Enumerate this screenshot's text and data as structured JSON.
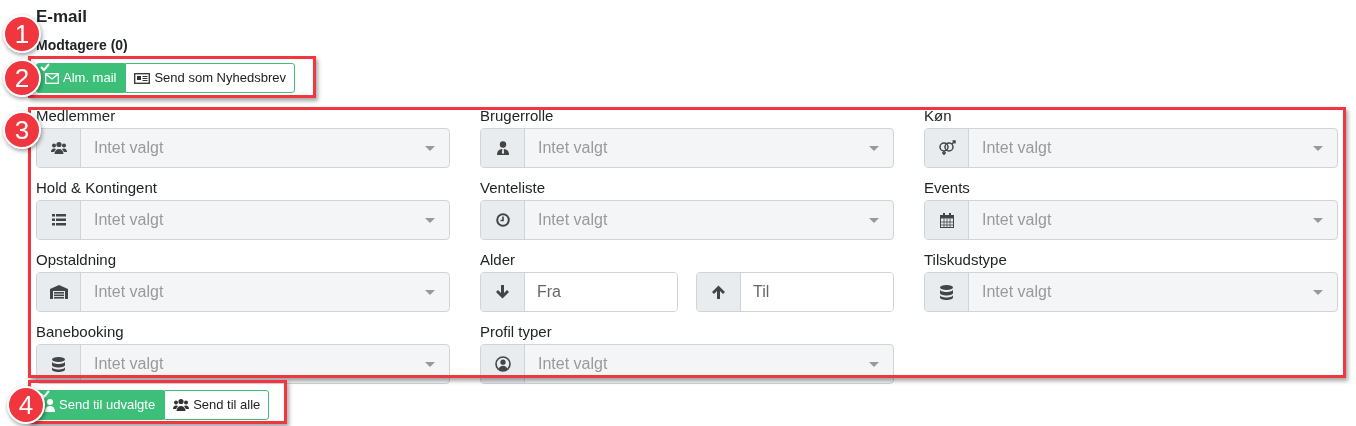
{
  "heading": "E-mail",
  "recipients_label": "Modtagere (0)",
  "mail_type_buttons": [
    {
      "label": "Alm. mail",
      "selected": true
    },
    {
      "label": "Send som Nyhedsbrev",
      "selected": false
    }
  ],
  "filters": [
    {
      "kind": "select",
      "label": "Medlemmer",
      "placeholder": "Intet valgt"
    },
    {
      "kind": "select",
      "label": "Brugerrolle",
      "placeholder": "Intet valgt"
    },
    {
      "kind": "select",
      "label": "Køn",
      "placeholder": "Intet valgt"
    },
    {
      "kind": "select",
      "label": "Hold & Kontingent",
      "placeholder": "Intet valgt"
    },
    {
      "kind": "select",
      "label": "Venteliste",
      "placeholder": "Intet valgt"
    },
    {
      "kind": "select",
      "label": "Events",
      "placeholder": "Intet valgt"
    },
    {
      "kind": "select",
      "label": "Opstaldning",
      "placeholder": "Intet valgt"
    },
    {
      "kind": "range",
      "label": "Alder",
      "fields": [
        {
          "placeholder": "Fra"
        },
        {
          "placeholder": "Til"
        }
      ]
    },
    {
      "kind": "select",
      "label": "Tilskudstype",
      "placeholder": "Intet valgt"
    },
    {
      "kind": "select",
      "label": "Banebooking",
      "placeholder": "Intet valgt"
    },
    {
      "kind": "select",
      "label": "Profil typer",
      "placeholder": "Intet valgt"
    }
  ],
  "send_buttons": [
    {
      "label": "Send til udvalgte",
      "selected": true
    },
    {
      "label": "Send til alle",
      "selected": false
    }
  ],
  "callouts": [
    {
      "number": "1"
    },
    {
      "number": "2"
    },
    {
      "number": "3"
    },
    {
      "number": "4"
    }
  ]
}
